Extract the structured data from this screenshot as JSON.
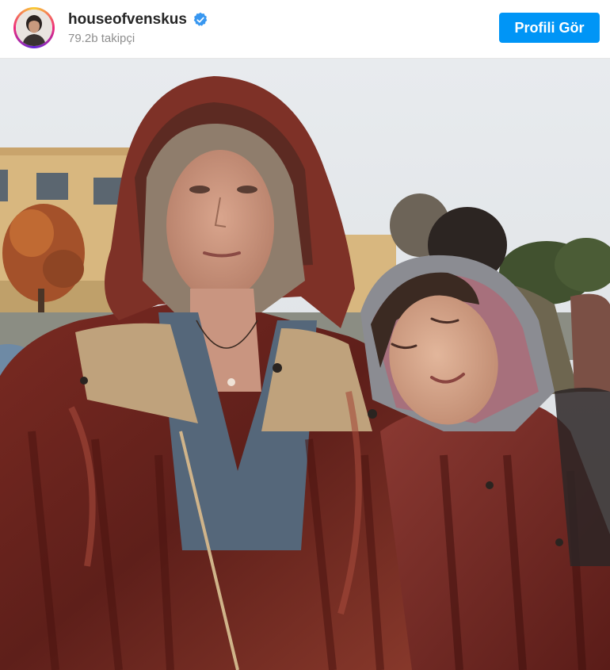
{
  "header": {
    "username": "houseofvenskus",
    "verified_icon": "verified-badge-icon",
    "followers": "79.2b takipçi",
    "view_profile_label": "Profili Gör",
    "accent_color": "#0095f6"
  },
  "post": {
    "media_type": "photo"
  }
}
